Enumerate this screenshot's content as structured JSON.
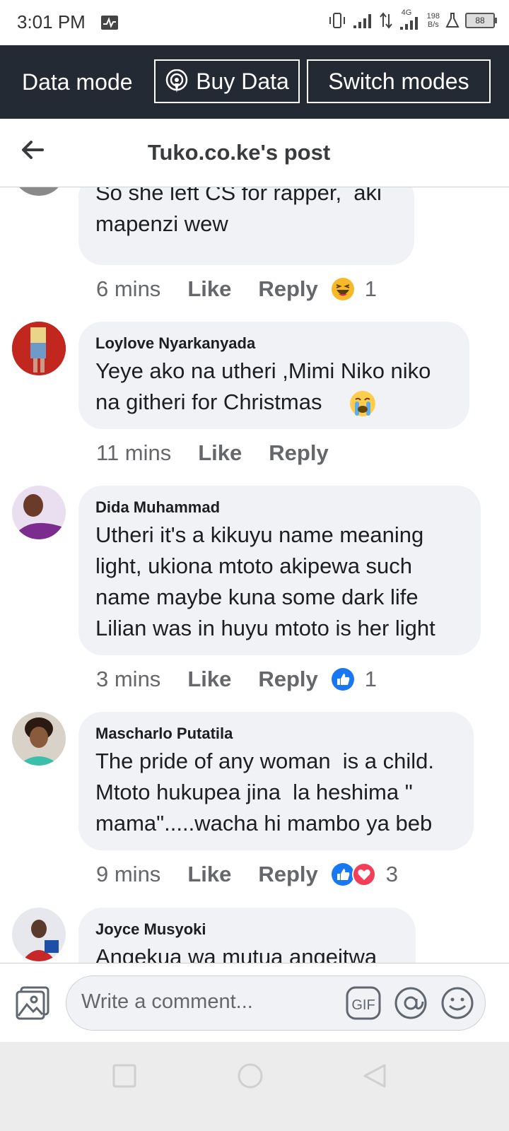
{
  "status": {
    "time": "3:01 PM",
    "speed_value": "198",
    "speed_unit": "B/s",
    "network": "4G",
    "battery": "88"
  },
  "data_bar": {
    "mode_label": "Data mode",
    "buy_label": "Buy Data",
    "switch_label": "Switch modes"
  },
  "header": {
    "title": "Tuko.co.ke's post"
  },
  "comments": [
    {
      "author": "",
      "text": "So she left CS for rapper,  aki\nmapenzi wew",
      "time": "6 mins",
      "like": "Like",
      "reply": "Reply",
      "reactions": [
        "haha-icon"
      ],
      "count": "1"
    },
    {
      "author": "Loylove Nyarkanyada",
      "text": "Yeye ako na utheri ,Mimi Niko niko\nna githeri for Christmas",
      "time": "11 mins",
      "like": "Like",
      "reply": "Reply",
      "reactions": [],
      "count": ""
    },
    {
      "author": "Dida Muhammad",
      "text": "Utheri it's a kikuyu name meaning\nlight, ukiona mtoto akipewa such\nname maybe kuna some dark life\nLilian was in huyu mtoto is her light",
      "time": "3 mins",
      "like": "Like",
      "reply": "Reply",
      "reactions": [
        "like-icon"
      ],
      "count": "1"
    },
    {
      "author": "Mascharlo Putatila",
      "text": "The pride of any woman  is a child.\nMtoto hukupea jina  la heshima \"\nmama\".....wacha hi mambo ya beb",
      "time": "9 mins",
      "like": "Like",
      "reply": "Reply",
      "reactions": [
        "like-icon",
        "love-icon"
      ],
      "count": "3"
    },
    {
      "author": "Joyce Musyoki",
      "text": "Angekua wa mutua angeitwa",
      "time": "",
      "like": "",
      "reply": "",
      "reactions": [],
      "count": ""
    }
  ],
  "composer": {
    "placeholder": "Write a comment..."
  }
}
